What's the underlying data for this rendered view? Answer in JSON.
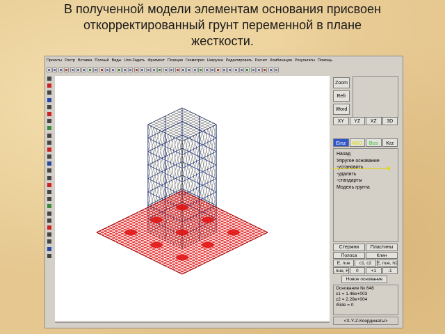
{
  "slide": {
    "title_line1": "В полученной модели элементам основания присвоен",
    "title_line2": "откорректированный грунт переменной в плане",
    "title_line3": "жесткости."
  },
  "menubar": {
    "items": [
      "Проекты",
      "Растр",
      "Вставка",
      "Полный",
      "Виды",
      "Uno-Задать",
      "Фрагмент",
      "Позиции",
      "Геометрия",
      "Нагрузка",
      "Редактировать",
      "Расчет",
      "Комбинации",
      "Результаты",
      "Помощь"
    ]
  },
  "right_panel": {
    "zoom_label": "Zoom",
    "refr_label": "Refr",
    "word_label": "Word",
    "views": [
      "XY",
      "YZ",
      "XZ",
      "3D"
    ],
    "modes": [
      "Einz",
      "ABG",
      "Bos",
      "Krz"
    ],
    "menu": {
      "back": "Назад",
      "elastic_base": "Упругое основание",
      "set": "-установить",
      "delete": "-удалить",
      "standard": "-стандарты",
      "soil_model": "Модель грунта"
    },
    "tabs": [
      "Стержни",
      "Пластины"
    ],
    "grid_rows": [
      [
        "Полоса",
        "Клин"
      ],
      [
        "E, nue",
        "c1, c2",
        "E, nue, h1"
      ],
      [
        "E, nue, H2",
        "0",
        "+1",
        "-1"
      ]
    ],
    "new_base_label": "Новое основание",
    "info": {
      "line1": "Основание № 648",
      "line2": "c1   = 1.46e+003",
      "line3": "c2   = 2.29e+004",
      "line4": "iSide  = 0"
    },
    "coords_label": "<X-Y-Z-Координаты>"
  },
  "colors": {
    "mesh_red": "#e01010",
    "frame_blue": "#1f3a8f",
    "grid_black": "#1a1a1a",
    "mode_active": "#2f56c9"
  }
}
